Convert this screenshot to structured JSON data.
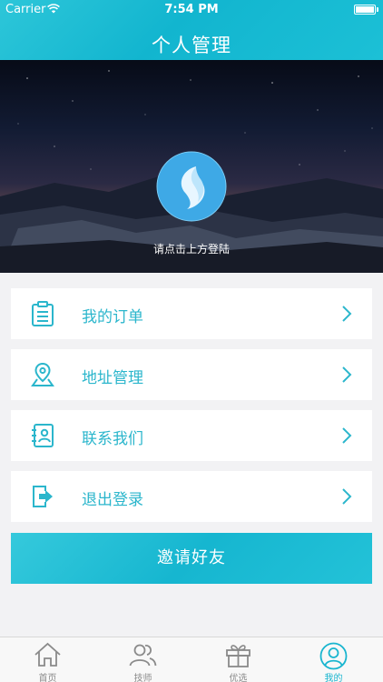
{
  "status_bar": {
    "carrier": "Carrier",
    "time": "7:54 PM"
  },
  "header": {
    "title": "个人管理"
  },
  "profile": {
    "login_hint": "请点击上方登陆"
  },
  "menu": [
    {
      "label": "我的订单",
      "icon": "order-list-icon"
    },
    {
      "label": "地址管理",
      "icon": "map-pin-icon"
    },
    {
      "label": "联系我们",
      "icon": "contact-card-icon"
    },
    {
      "label": "退出登录",
      "icon": "logout-icon"
    }
  ],
  "invite": {
    "label": "邀请好友"
  },
  "tabs": [
    {
      "label": "首页",
      "icon": "home-icon",
      "active": false
    },
    {
      "label": "技师",
      "icon": "users-icon",
      "active": false
    },
    {
      "label": "优选",
      "icon": "gift-icon",
      "active": false
    },
    {
      "label": "我的",
      "icon": "profile-icon",
      "active": true
    }
  ],
  "colors": {
    "accent": "#19b5cf",
    "header": "#12b5cf",
    "background": "#f2f2f4"
  }
}
